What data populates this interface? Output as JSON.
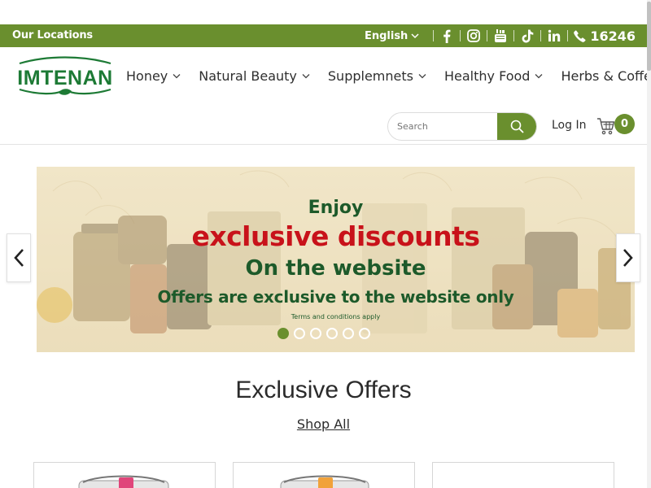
{
  "topbar": {
    "locations_label": "Our Locations",
    "language_label": "English",
    "phone_number": "16246",
    "social_icons": [
      "facebook-icon",
      "instagram-icon",
      "youtube-icon",
      "tiktok-icon",
      "linkedin-icon"
    ]
  },
  "header": {
    "logo_text": "IMTENAN",
    "nav": [
      {
        "label": "Honey"
      },
      {
        "label": "Natural Beauty"
      },
      {
        "label": "Supplemnets"
      },
      {
        "label": "Healthy Food"
      },
      {
        "label": "Herbs & Coffee"
      }
    ],
    "search_placeholder": "Search",
    "login_label": "Log In",
    "cart_count": "0"
  },
  "hero": {
    "line1": "Enjoy",
    "line2": "exclusive discounts",
    "line3": "On the website",
    "line4": "Offers are exclusive to the website only",
    "line5": "Terms and conditions apply",
    "slide_count": 6,
    "active_slide": 1
  },
  "offers": {
    "title": "Exclusive Offers",
    "shop_all_label": "Shop All"
  },
  "colors": {
    "brand_green": "#6a8f2e",
    "dark_green": "#1d5a2a",
    "discount_red": "#c8121a",
    "banner_bg": "#efe4c6"
  }
}
